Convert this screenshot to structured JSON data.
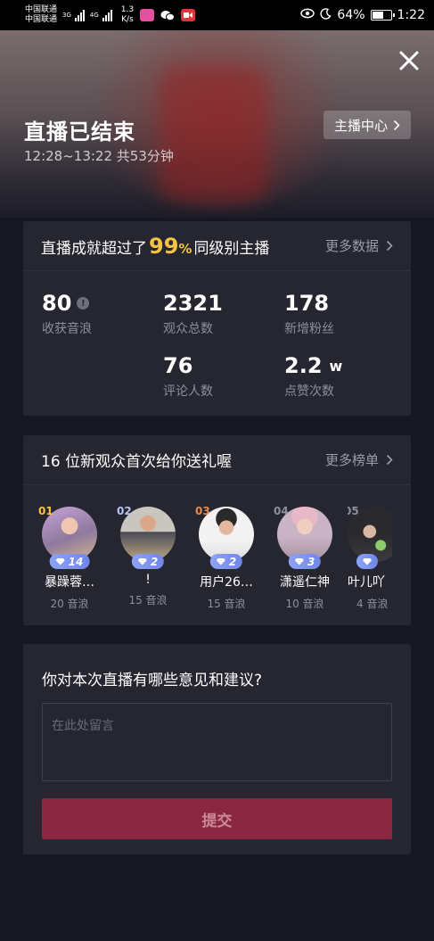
{
  "status_bar": {
    "carrier_1": "中国联通",
    "carrier_2": "中国联通",
    "net_1": "3G",
    "net_2": "4G",
    "speed_value": "1.3",
    "speed_unit": "K/s",
    "battery": "64%",
    "time": "1:22"
  },
  "hero": {
    "title": "直播已结束",
    "subtitle": "12:28~13:22 共53分钟",
    "host_center_label": "主播中心"
  },
  "achievement": {
    "prefix": "直播成就超过了",
    "percent": "99",
    "percent_sign": "%",
    "suffix": "同级别主播",
    "more_label": "更多数据",
    "stats": [
      {
        "value": "80",
        "unit": "",
        "label": "收获音浪"
      },
      {
        "value": "2321",
        "unit": "",
        "label": "观众总数"
      },
      {
        "value": "178",
        "unit": "",
        "label": "新增粉丝"
      },
      {
        "value": "76",
        "unit": "",
        "label": "评论人数"
      },
      {
        "value": "2.2",
        "unit": "w",
        "label": "点赞次数"
      }
    ]
  },
  "gifts": {
    "title": "16 位新观众首次给你送礼喔",
    "more_label": "更多榜单",
    "viewers": [
      {
        "rank": "01",
        "rank_color": "#f5c343",
        "level": "14",
        "name": "暴躁蓉…",
        "sub": "20 音浪"
      },
      {
        "rank": "02",
        "rank_color": "#b7c3f0",
        "level": "2",
        "name": "!",
        "sub": "15 音浪"
      },
      {
        "rank": "03",
        "rank_color": "#e58a56",
        "level": "2",
        "name": "用户26…",
        "sub": "15 音浪"
      },
      {
        "rank": "04",
        "rank_color": "#8f8f9b",
        "level": "3",
        "name": "潇遥仁神",
        "sub": "10 音浪"
      },
      {
        "rank": "05",
        "rank_color": "#8f8f9b",
        "level": "",
        "name": "叶儿吖",
        "sub": "4 音浪"
      }
    ]
  },
  "feedback": {
    "title": "你对本次直播有哪些意见和建议?",
    "placeholder": "在此处留言",
    "submit_label": "提交"
  }
}
